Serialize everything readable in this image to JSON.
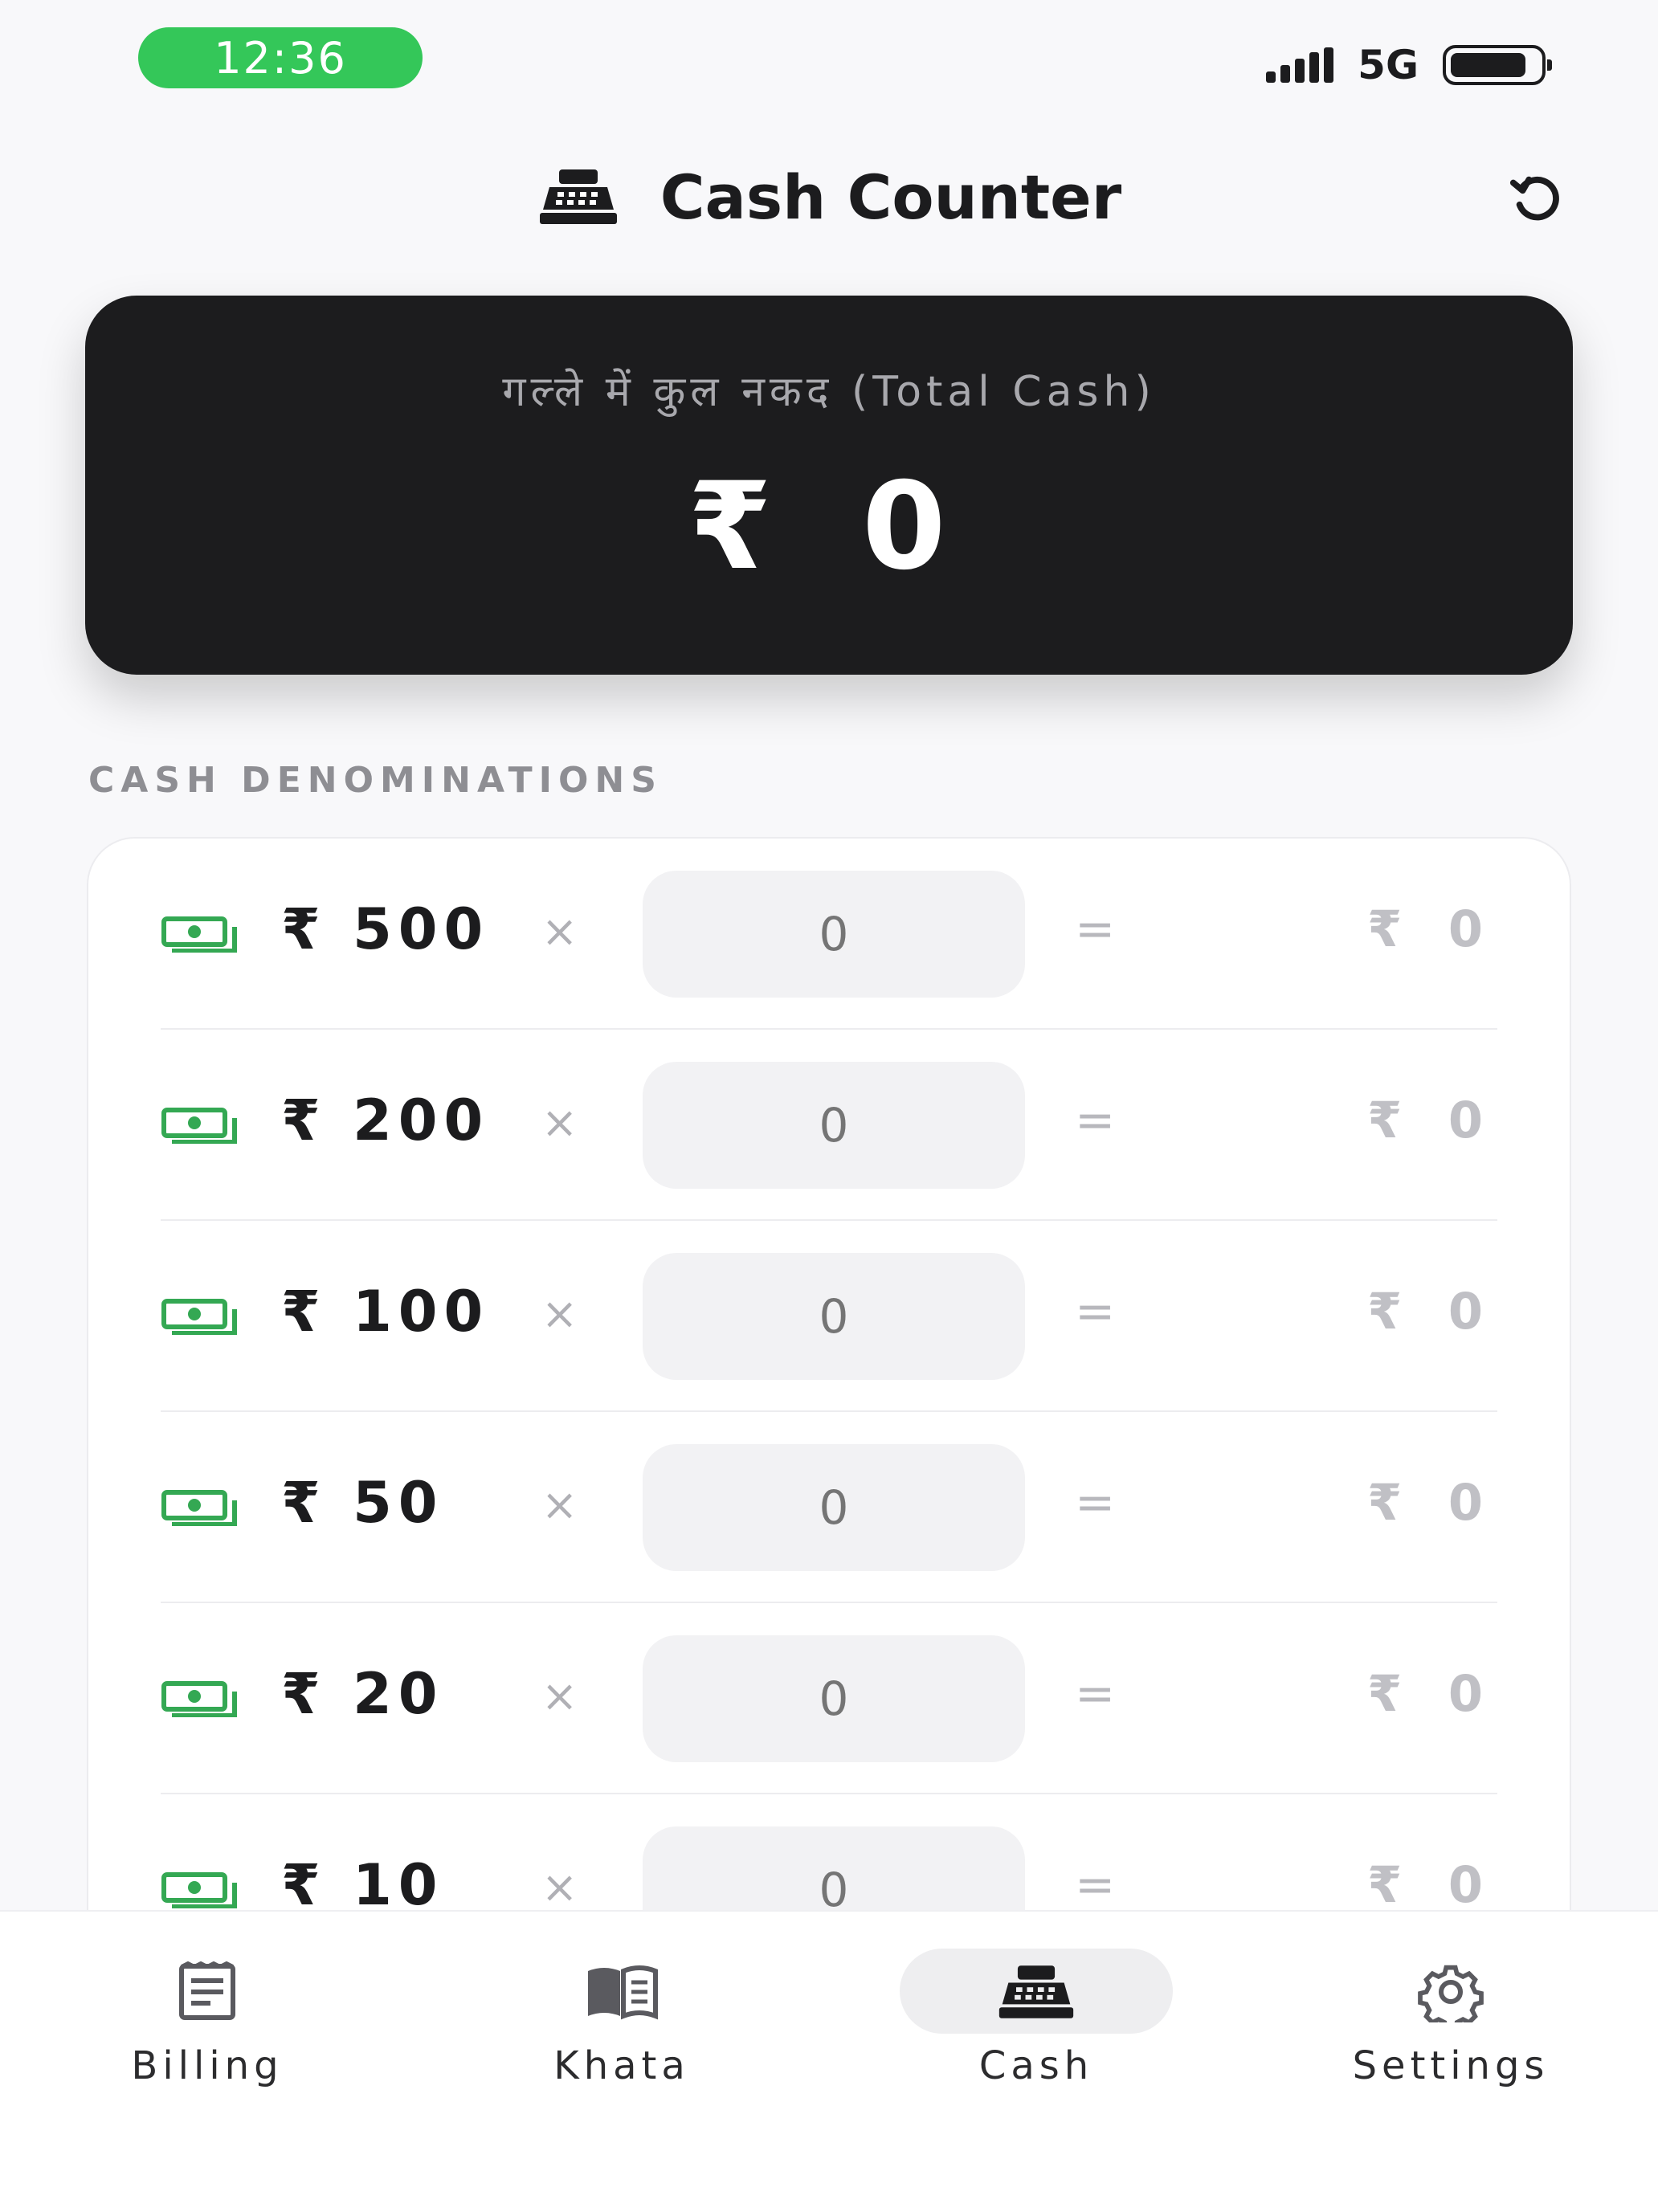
{
  "status_bar": {
    "time": "12:36",
    "network": "5G"
  },
  "header": {
    "title": "Cash Counter"
  },
  "summary": {
    "label": "गल्ले में कुल नकद (Total Cash)",
    "amount": "₹ 0"
  },
  "section_label": "CASH DENOMINATIONS",
  "denominations": [
    {
      "label": "₹ 500",
      "times": "×",
      "count": "",
      "placeholder": "0",
      "equals": "=",
      "total": "₹ 0"
    },
    {
      "label": "₹ 200",
      "times": "×",
      "count": "",
      "placeholder": "0",
      "equals": "=",
      "total": "₹ 0"
    },
    {
      "label": "₹ 100",
      "times": "×",
      "count": "",
      "placeholder": "0",
      "equals": "=",
      "total": "₹ 0"
    },
    {
      "label": "₹ 50",
      "times": "×",
      "count": "",
      "placeholder": "0",
      "equals": "=",
      "total": "₹ 0"
    },
    {
      "label": "₹ 20",
      "times": "×",
      "count": "",
      "placeholder": "0",
      "equals": "=",
      "total": "₹ 0"
    },
    {
      "label": "₹ 10",
      "times": "×",
      "count": "",
      "placeholder": "0",
      "equals": "=",
      "total": "₹ 0"
    }
  ],
  "nav": [
    {
      "label": "Billing",
      "icon": "receipt-icon",
      "active": false
    },
    {
      "label": "Khata",
      "icon": "book-icon",
      "active": false
    },
    {
      "label": "Cash",
      "icon": "cash-register-icon",
      "active": true
    },
    {
      "label": "Settings",
      "icon": "gear-icon",
      "active": false
    }
  ],
  "colors": {
    "accent_green": "#34c759",
    "card_dark": "#1c1c1e",
    "note_icon": "#34a853"
  }
}
